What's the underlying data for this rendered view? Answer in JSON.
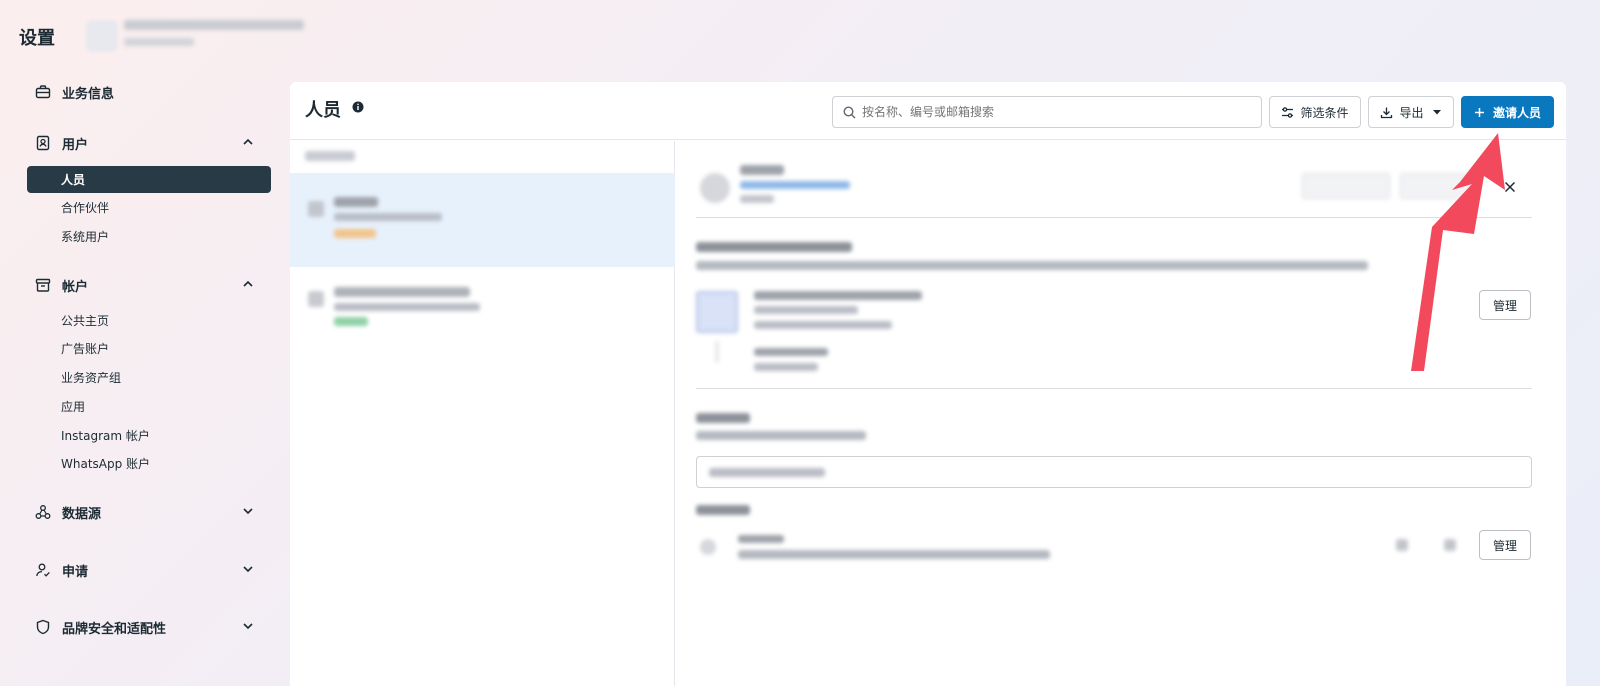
{
  "header": {
    "settings_title": "设置"
  },
  "sidebar": {
    "sections": [
      {
        "label": "业务信息"
      },
      {
        "label": "用户",
        "items": [
          {
            "label": "人员"
          },
          {
            "label": "合作伙伴"
          },
          {
            "label": "系统用户"
          }
        ]
      },
      {
        "label": "帐户",
        "items": [
          {
            "label": "公共主页"
          },
          {
            "label": "广告账户"
          },
          {
            "label": "业务资产组"
          },
          {
            "label": "应用"
          },
          {
            "label": "Instagram 帐户"
          },
          {
            "label": "WhatsApp 账户"
          }
        ]
      },
      {
        "label": "数据源"
      },
      {
        "label": "申请"
      },
      {
        "label": "品牌安全和适配性"
      }
    ]
  },
  "main": {
    "title": "人员",
    "search_placeholder": "按名称、编号或邮箱搜索",
    "filter_label": "筛选条件",
    "export_label": "导出",
    "invite_label": "邀请人员"
  },
  "detail": {
    "manage_label_1": "管理",
    "manage_label_2": "管理"
  },
  "colors": {
    "accent": "#0a78be",
    "sidebar_active": "#283a45",
    "annotation_arrow": "#f2495c"
  }
}
